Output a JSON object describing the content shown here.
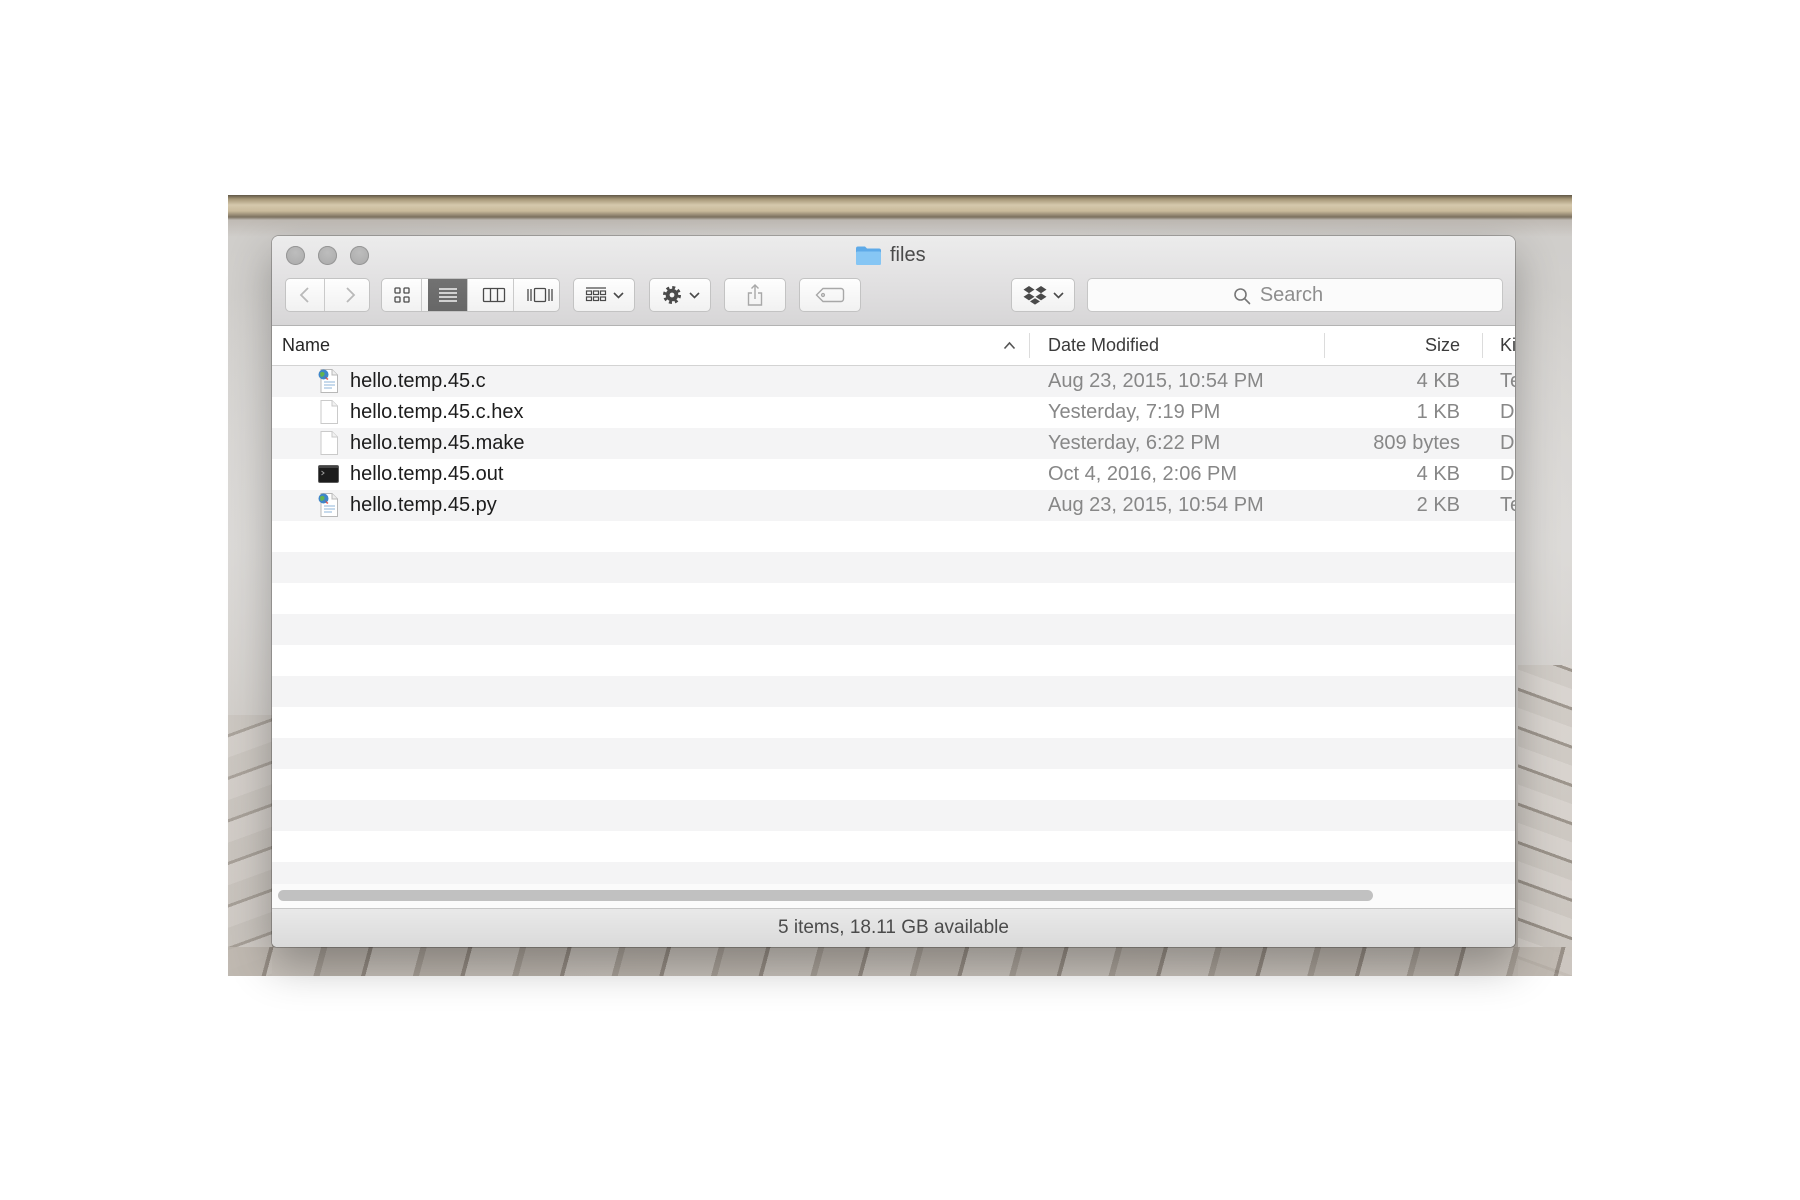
{
  "window": {
    "title": "files",
    "title_icon": "folder-icon",
    "controls": [
      "close-button",
      "minimize-button",
      "zoom-button"
    ]
  },
  "toolbar": {
    "back_icon": "chevron-left-icon",
    "forward_icon": "chevron-right-icon",
    "view_modes": [
      {
        "name": "icon-view",
        "icon": "icon-view-icon",
        "selected": false
      },
      {
        "name": "list-view",
        "icon": "list-view-icon",
        "selected": true
      },
      {
        "name": "column-view",
        "icon": "column-view-icon",
        "selected": false
      },
      {
        "name": "cover-flow",
        "icon": "cover-flow-icon",
        "selected": false
      }
    ],
    "arrange_icon": "arrange-grid-icon",
    "action_icon": "gear-icon",
    "share_icon": "share-icon",
    "tag_icon": "tag-icon",
    "dropbox_icon": "dropbox-icon",
    "search_icon": "search-icon",
    "search_placeholder": "Search"
  },
  "columns": [
    {
      "label": "Name",
      "sorted": "ascending"
    },
    {
      "label": "Date Modified"
    },
    {
      "label": "Size"
    },
    {
      "label": "Ki"
    }
  ],
  "files": [
    {
      "name": "hello.temp.45.c",
      "date": "Aug 23, 2015, 10:54 PM",
      "size": "4 KB",
      "kind": "Te",
      "icon": "source-file-icon"
    },
    {
      "name": "hello.temp.45.c.hex",
      "date": "Yesterday, 7:19 PM",
      "size": "1 KB",
      "kind": "D",
      "icon": "blank-document-icon"
    },
    {
      "name": "hello.temp.45.make",
      "date": "Yesterday, 6:22 PM",
      "size": "809 bytes",
      "kind": "D",
      "icon": "blank-document-icon"
    },
    {
      "name": "hello.temp.45.out",
      "date": "Oct 4, 2016, 2:06 PM",
      "size": "4 KB",
      "kind": "D",
      "icon": "terminal-executable-icon"
    },
    {
      "name": "hello.temp.45.py",
      "date": "Aug 23, 2015, 10:54 PM",
      "size": "2 KB",
      "kind": "Te",
      "icon": "source-file-icon"
    }
  ],
  "status": {
    "text": "5 items, 18.11 GB available"
  },
  "colors": {
    "folder": "#86c6f4",
    "selected_segment": "#676767",
    "row_stripe": "#f4f4f5",
    "secondary_text": "#878787"
  }
}
